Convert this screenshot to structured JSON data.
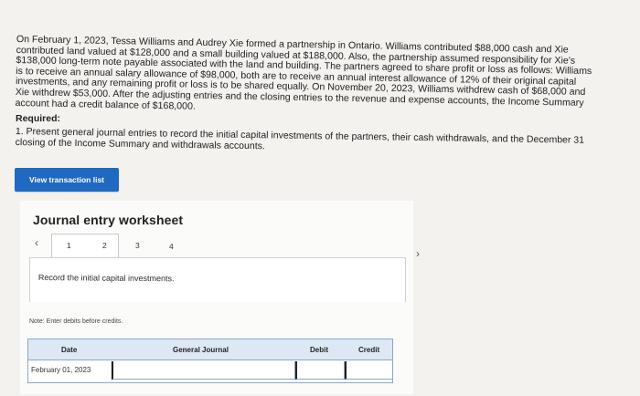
{
  "problem": {
    "text": "On February 1, 2023, Tessa Williams and Audrey Xie formed a partnership in Ontario. Williams contributed $88,000 cash and Xie\ncontributed land valued at $128,000 and a small building valued at $188,000. Also, the partnership assumed responsibility for Xie's\n$138,000 long-term note payable associated with the land and building. The partners agreed to share profit or loss as follows: Williams\nis to receive an annual salary allowance of $98,000, both are to receive an annual interest allowance of 12% of their original capital\ninvestments, and any remaining profit or loss is to be shared equally. On November 20, 2023, Williams withdrew cash of $68,000 and\nXie withdrew $53,000. After the adjusting entries and the closing entries to the revenue and expense accounts, the Income Summary\naccount had a credit balance of $168,000."
  },
  "required": {
    "title": "Required:",
    "text": "1. Present general journal entries to record the initial capital investments of the partners, their cash withdrawals, and the December 31\nclosing of the Income Summary and withdrawals accounts."
  },
  "buttons": {
    "view_transaction_list": "View transaction list"
  },
  "worksheet": {
    "title": "Journal entry worksheet",
    "tabs": [
      "1",
      "2",
      "3",
      "4"
    ],
    "active_tab": "1",
    "instruction": "Record the initial capital investments.",
    "note": "Note: Enter debits before credits.",
    "table": {
      "headers": {
        "date": "Date",
        "journal": "General Journal",
        "debit": "Debit",
        "credit": "Credit"
      },
      "row": {
        "date": "February 01, 2023"
      }
    }
  },
  "icons": {
    "prev": "chevron-left-icon",
    "next": "chevron-right-icon"
  },
  "colors": {
    "primary_button": "#1f6ac0",
    "table_header": "#dde8f4",
    "table_border": "#8ca7c6"
  }
}
